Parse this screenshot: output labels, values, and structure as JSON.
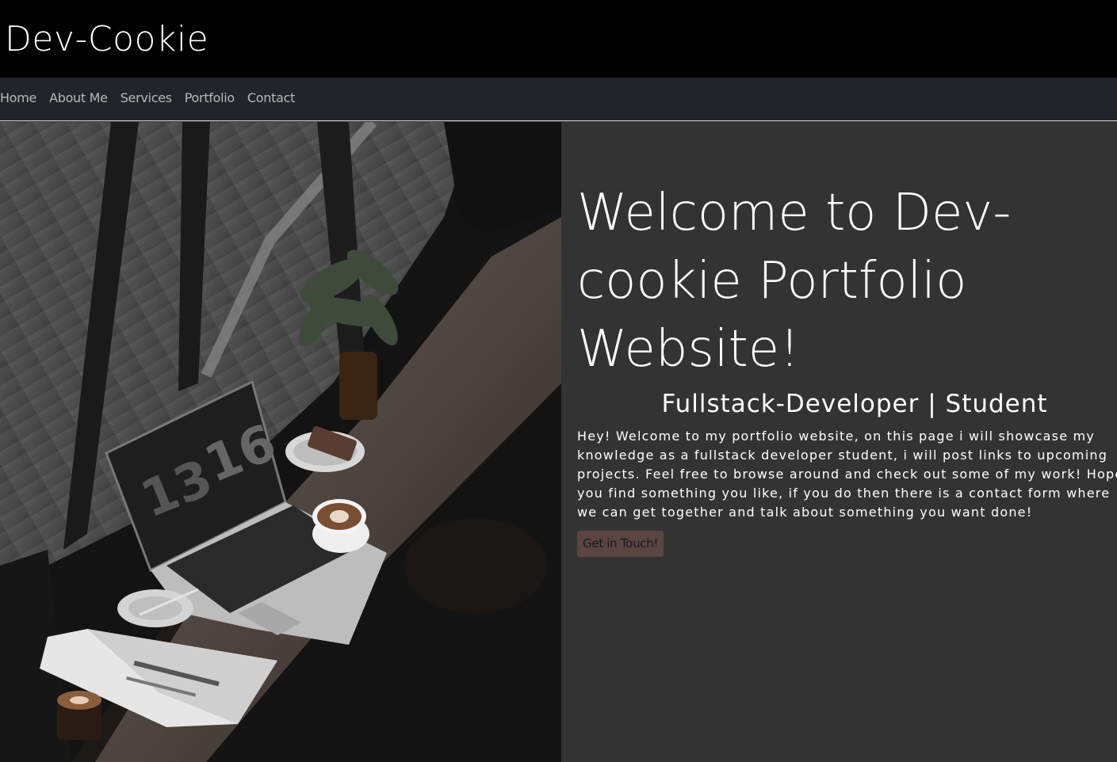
{
  "header": {
    "brand": "Dev-Cookie"
  },
  "nav": {
    "items": [
      {
        "label": "Home"
      },
      {
        "label": "About Me"
      },
      {
        "label": "Services"
      },
      {
        "label": "Portfolio"
      },
      {
        "label": "Contact"
      }
    ]
  },
  "hero": {
    "image_icon": "workspace-photo",
    "clock_hours": "13",
    "clock_minutes": "16",
    "title": "Welcome to Dev-cookie Portfolio Website!",
    "subtitle": "Fullstack-Developer | Student",
    "body": "Hey! Welcome to my portfolio website, on this page i will showcase my knowledge as a fullstack developer student, i will post links to upcoming projects. Feel free to browse around and check out some of my work! Hope you find something you like, if you do then there is a contact form where we can get together and talk about something you want done!",
    "cta_label": "Get in Touch!"
  },
  "colors": {
    "topbar": "#000000",
    "navbar": "#212529",
    "hero_panel": "#333333",
    "cta_button": "#5a4542"
  }
}
